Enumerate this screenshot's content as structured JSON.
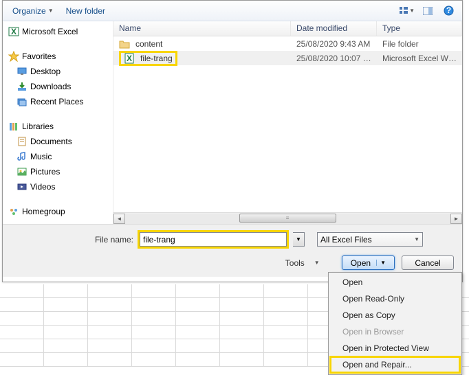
{
  "toolbar": {
    "organize": "Organize",
    "new_folder": "New folder"
  },
  "sidebar": {
    "groups": [
      {
        "icon": "excel",
        "label": "Microsoft Excel",
        "root": true,
        "children": []
      },
      {
        "icon": "star",
        "label": "Favorites",
        "root": true,
        "children": [
          {
            "icon": "desktop",
            "label": "Desktop"
          },
          {
            "icon": "downloads",
            "label": "Downloads"
          },
          {
            "icon": "recent",
            "label": "Recent Places"
          }
        ]
      },
      {
        "icon": "libraries",
        "label": "Libraries",
        "root": true,
        "children": [
          {
            "icon": "documents",
            "label": "Documents"
          },
          {
            "icon": "music",
            "label": "Music"
          },
          {
            "icon": "pictures",
            "label": "Pictures"
          },
          {
            "icon": "videos",
            "label": "Videos"
          }
        ]
      },
      {
        "icon": "homegroup",
        "label": "Homegroup",
        "root": true,
        "children": []
      }
    ]
  },
  "filelist": {
    "cols": {
      "name": "Name",
      "date": "Date modified",
      "type": "Type"
    },
    "rows": [
      {
        "icon": "folder",
        "name": "content",
        "date": "25/08/2020 9:43 AM",
        "type": "File folder",
        "selected": false,
        "highlight": false
      },
      {
        "icon": "excel-file",
        "name": "file-trang",
        "date": "25/08/2020 10:07 …",
        "type": "Microsoft Excel W…",
        "selected": true,
        "highlight": true
      }
    ]
  },
  "bottom": {
    "filename_label": "File name:",
    "filename_value": "file-trang",
    "filter": "All Excel Files",
    "tools": "Tools",
    "open": "Open",
    "cancel": "Cancel"
  },
  "dropdown": {
    "items": [
      {
        "label": "Open",
        "disabled": false,
        "hl": false
      },
      {
        "label": "Open Read-Only",
        "disabled": false,
        "hl": false
      },
      {
        "label": "Open as Copy",
        "disabled": false,
        "hl": false
      },
      {
        "label": "Open in Browser",
        "disabled": true,
        "hl": false
      },
      {
        "label": "Open in Protected View",
        "disabled": false,
        "hl": false
      },
      {
        "label": "Open and Repair...",
        "disabled": false,
        "hl": true
      }
    ]
  }
}
